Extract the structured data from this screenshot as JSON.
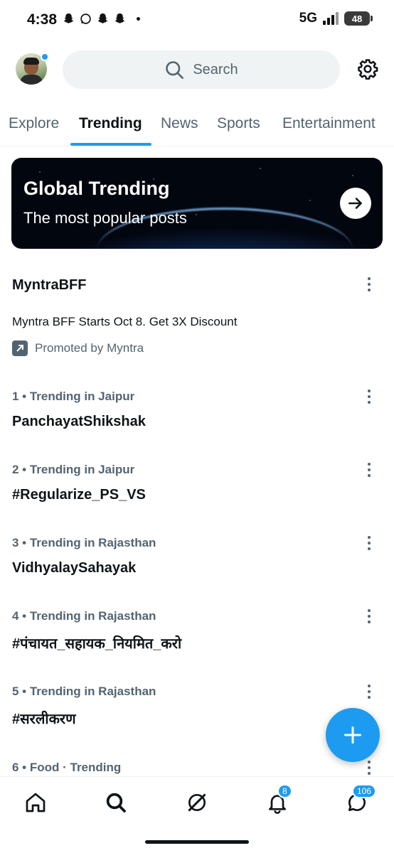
{
  "status_bar": {
    "time": "4:38",
    "network": "5G",
    "battery": "48"
  },
  "header": {
    "search_placeholder": "Search"
  },
  "tabs": [
    "Explore",
    "Trending",
    "News",
    "Sports",
    "Entertainment"
  ],
  "active_tab": "Trending",
  "banner": {
    "title": "Global Trending",
    "subtitle": "The most popular posts"
  },
  "promoted": {
    "title": "MyntraBFF",
    "description": "Myntra BFF Starts Oct 8. Get 3X Discount",
    "promoted_by": "Promoted by Myntra"
  },
  "trends": [
    {
      "meta": "1 • Trending in Jaipur",
      "name": "PanchayatShikshak"
    },
    {
      "meta": "2 • Trending in Jaipur",
      "name": "#Regularize_PS_VS"
    },
    {
      "meta": "3 • Trending in Rajasthan",
      "name": "VidhyalaySahayak"
    },
    {
      "meta": "4 • Trending in Rajasthan",
      "name": "#पंचायत_सहायक_नियमित_करो"
    },
    {
      "meta": "5 • Trending in Rajasthan",
      "name": "#सरलीकरण"
    },
    {
      "meta": "6 • Food · Trending",
      "name": ""
    }
  ],
  "bottom_nav": {
    "items": [
      "home-icon",
      "search-icon",
      "grok-icon",
      "notifications-icon",
      "messages-icon"
    ],
    "notifications_badge": "8",
    "messages_badge": "106"
  },
  "colors": {
    "accent": "#1d9bf0",
    "text": "#0f1419",
    "secondary": "#536471"
  }
}
